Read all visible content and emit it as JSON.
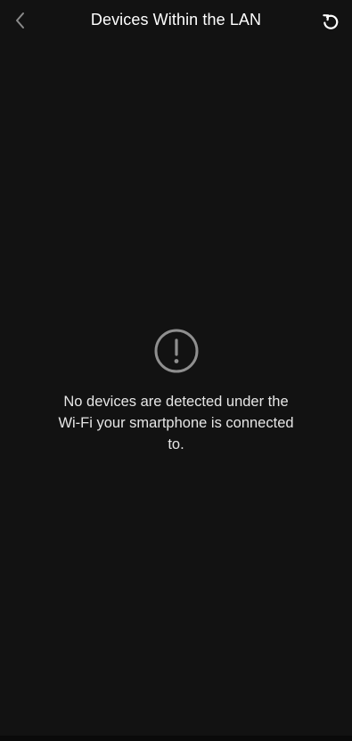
{
  "header": {
    "title": "Devices Within the LAN",
    "back_icon": "chevron-left-icon",
    "refresh_icon": "refresh-icon"
  },
  "empty_state": {
    "icon": "alert-circle-icon",
    "message": "No devices are detected under the Wi-Fi your smartphone is connected to."
  },
  "colors": {
    "background": "#121212",
    "title_text": "#ffffff",
    "message_text": "#e6e6e6",
    "back_icon": "#8a8a8a",
    "alert_icon": "#8f8f8f"
  }
}
